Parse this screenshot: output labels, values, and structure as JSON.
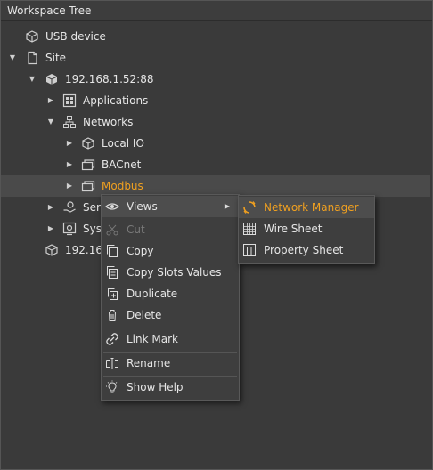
{
  "panel": {
    "title": "Workspace Tree"
  },
  "tree": {
    "usb": "USB device",
    "site": "Site",
    "device": "192.168.1.52:88",
    "applications": "Applications",
    "networks": "Networks",
    "local_io": "Local IO",
    "bacnet": "BACnet",
    "modbus": "Modbus",
    "services_partial": "Serv",
    "system_partial": "Syst",
    "device2_partial": "192.168"
  },
  "context_menu": {
    "views": "Views",
    "cut": "Cut",
    "copy": "Copy",
    "copy_slots": "Copy Slots Values",
    "duplicate": "Duplicate",
    "delete": "Delete",
    "link_mark": "Link Mark",
    "rename": "Rename",
    "show_help": "Show Help"
  },
  "views_submenu": {
    "network_manager": "Network Manager",
    "wire_sheet": "Wire Sheet",
    "property_sheet": "Property Sheet"
  },
  "colors": {
    "accent": "#f0a020",
    "background": "#3a3a3a",
    "menu": "#3e3e3e"
  }
}
